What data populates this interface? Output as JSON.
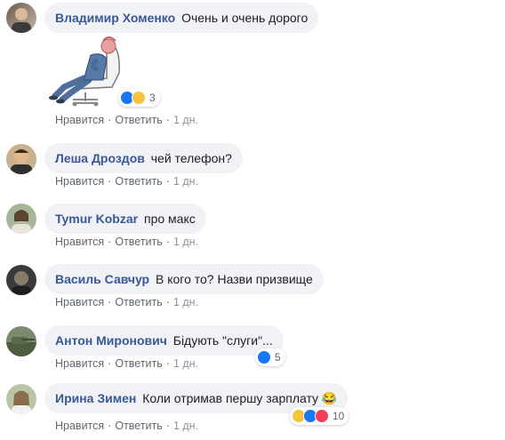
{
  "comments": [
    {
      "author": "Владимир Хоменко",
      "text": "Очень и очень дорого",
      "actions": {
        "like": "Нравится",
        "reply": "Ответить",
        "time": "1 дн."
      },
      "reactions": {
        "types": [
          "like",
          "haha"
        ],
        "count": "3"
      },
      "has_sticker": true
    },
    {
      "author": "Леша Дроздов",
      "text": "чей телефон?",
      "actions": {
        "like": "Нравится",
        "reply": "Ответить",
        "time": "1 дн."
      }
    },
    {
      "author": "Tymur Kobzar",
      "text": "про макс",
      "actions": {
        "like": "Нравится",
        "reply": "Ответить",
        "time": "1 дн."
      }
    },
    {
      "author": "Василь Савчур",
      "text": "В кого то? Назви призвище",
      "actions": {
        "like": "Нравится",
        "reply": "Ответить",
        "time": "1 дн."
      }
    },
    {
      "author": "Антон Миронович",
      "text": "Бідують \"слуги\"...",
      "actions": {
        "like": "Нравится",
        "reply": "Ответить",
        "time": "1 дн."
      },
      "reactions": {
        "types": [
          "like"
        ],
        "count": "5"
      }
    },
    {
      "author": "Ирина Зимен",
      "text": "Коли отримав першу зарплату",
      "emoji": "😂",
      "actions": {
        "like": "Нравится",
        "reply": "Ответить",
        "time": "1 дн."
      },
      "reactions": {
        "types": [
          "haha",
          "like",
          "love"
        ],
        "count": "10"
      }
    }
  ],
  "colors": {
    "author": "#385898",
    "bubble": "#f0f2f5",
    "like": "#1877f2",
    "haha": "#f7c33b",
    "love": "#f33e58"
  }
}
